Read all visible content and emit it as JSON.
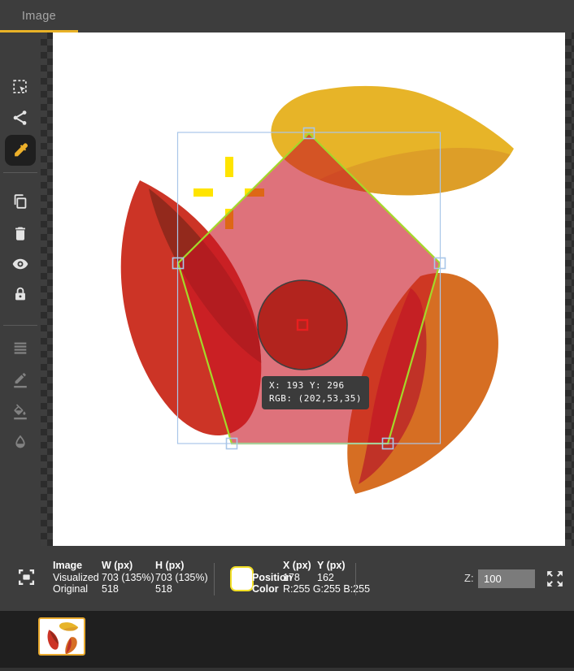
{
  "window": {
    "tab_label": "Image"
  },
  "toolbar": {
    "active_tool": "eyedropper",
    "tools": [
      "rectangle-select",
      "polyline",
      "eyedropper",
      "duplicate",
      "delete",
      "visibility",
      "lock",
      "reorder",
      "border-color",
      "fill-color",
      "opacity"
    ]
  },
  "canvas": {
    "tooltip_line1": "X: 193 Y: 296",
    "tooltip_line2": "RGB: (202,53,35)",
    "colors": {
      "blob_yellow": "#e7b428",
      "blob_yellow_dark": "#dd9e28",
      "blob_red": "#cc3426",
      "blob_red_dark": "#93291c",
      "blob_orange": "#d66e23",
      "blob_orange_dark": "#c03227",
      "pentagon_fill": "rgba(200,20,35,0.6)",
      "pentagon_stroke": "#a4d829",
      "circle_fill": "#b2241e",
      "circle_stroke": "#3f3f3f",
      "selection": "#a9c6e8",
      "marker": "#e81f1f",
      "crosshair": "#ffe400"
    }
  },
  "statusbar": {
    "image_table": {
      "h_image": "Image",
      "h_w": "W (px)",
      "h_h": "H (px)",
      "r1_label": "Visualized",
      "r1_w": "703 (135%)",
      "r1_h": "703 (135%)",
      "r2_label": "Original",
      "r2_w": "518",
      "r2_h": "518"
    },
    "pixel_table": {
      "h_x": "X (px)",
      "h_y": "Y (px)",
      "r1_label": "Position",
      "r1_x": "178",
      "r1_y": "162",
      "r2_label": "Color",
      "r2_value": "R:255 G:255 B:255"
    },
    "swatch_color": "#ffffff",
    "zoom_label": "Z:",
    "zoom_value": "100"
  }
}
